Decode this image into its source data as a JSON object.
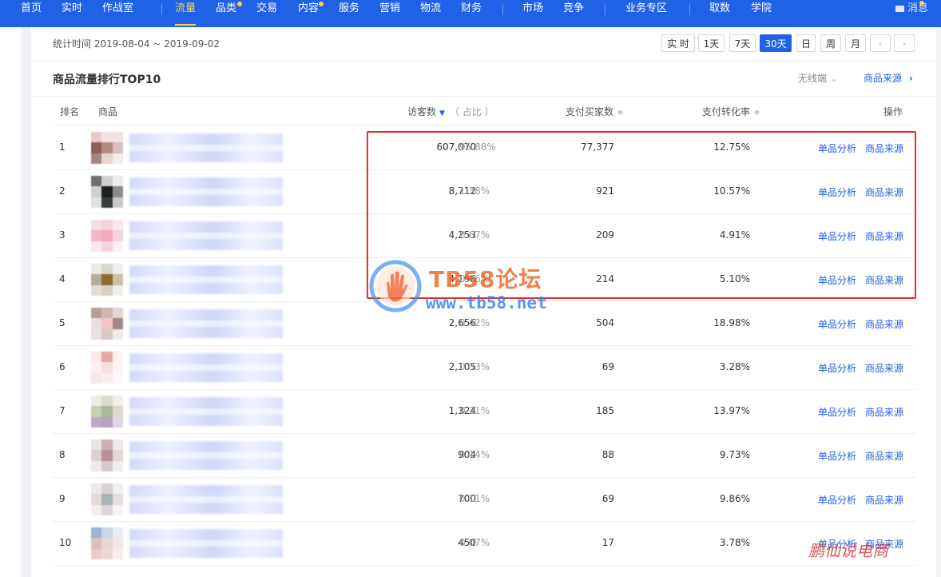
{
  "nav": {
    "items": [
      {
        "label": "首页",
        "active": false
      },
      {
        "label": "实时",
        "active": false
      },
      {
        "label": "作战室",
        "active": false
      },
      {
        "label": "流量",
        "active": true
      },
      {
        "label": "品类",
        "active": false,
        "dot": true
      },
      {
        "label": "交易",
        "active": false
      },
      {
        "label": "内容",
        "active": false,
        "dot": true
      },
      {
        "label": "服务",
        "active": false
      },
      {
        "label": "营销",
        "active": false
      },
      {
        "label": "物流",
        "active": false
      },
      {
        "label": "财务",
        "active": false
      },
      {
        "label": "市场",
        "active": false
      },
      {
        "label": "竞争",
        "active": false
      },
      {
        "label": "业务专区",
        "active": false
      },
      {
        "label": "取数",
        "active": false
      },
      {
        "label": "学院",
        "active": false
      }
    ],
    "message_label": "消息"
  },
  "date": {
    "range_text": "统计时间 2019-08-04 ~ 2019-09-02",
    "buttons": [
      {
        "label": "实 时",
        "active": false
      },
      {
        "label": "1天",
        "active": false
      },
      {
        "label": "7天",
        "active": false
      },
      {
        "label": "30天",
        "active": true
      },
      {
        "label": "日",
        "active": false
      },
      {
        "label": "周",
        "active": false
      },
      {
        "label": "月",
        "active": false
      }
    ],
    "prev_label": "‹",
    "next_label": "›"
  },
  "card": {
    "title": "商品流量排行TOP10",
    "device_label": "无线端",
    "source_link": "商品来源"
  },
  "table": {
    "headers": {
      "rank": "排名",
      "product": "商品",
      "visitors": "访客数",
      "share": "（ 占比 ）",
      "buyers": "支付买家数",
      "conversion": "支付转化率",
      "actions": "操作"
    },
    "action1": "单品分析",
    "action2": "商品来源",
    "rows": [
      {
        "rank": "1",
        "visitors": "607,070",
        "share": "95.88%",
        "buyers": "77,377",
        "conversion": "12.75%"
      },
      {
        "rank": "2",
        "visitors": "8,712",
        "share": "1.38%",
        "buyers": "921",
        "conversion": "10.57%"
      },
      {
        "rank": "3",
        "visitors": "4,253",
        "share": "0.67%",
        "buyers": "209",
        "conversion": "4.91%"
      },
      {
        "rank": "4",
        "visitors": "4,196",
        "share": "0.66%",
        "buyers": "214",
        "conversion": "5.10%"
      },
      {
        "rank": "5",
        "visitors": "2,656",
        "share": "0.42%",
        "buyers": "504",
        "conversion": "18.98%"
      },
      {
        "rank": "6",
        "visitors": "2,105",
        "share": "0.33%",
        "buyers": "69",
        "conversion": "3.28%"
      },
      {
        "rank": "7",
        "visitors": "1,324",
        "share": "0.21%",
        "buyers": "185",
        "conversion": "13.97%"
      },
      {
        "rank": "8",
        "visitors": "904",
        "share": "0.14%",
        "buyers": "88",
        "conversion": "9.73%"
      },
      {
        "rank": "9",
        "visitors": "700",
        "share": "0.11%",
        "buyers": "69",
        "conversion": "9.86%"
      },
      {
        "rank": "10",
        "visitors": "450",
        "share": "0.07%",
        "buyers": "17",
        "conversion": "3.78%"
      }
    ]
  },
  "watermark": {
    "brand": "TB58论坛",
    "url": "www.tb58.net",
    "corner": "鹏仙说电商"
  },
  "colors": {
    "nav_bg": "#2062e6",
    "nav_active": "#ffd34e",
    "link": "#2062e6",
    "highlight_box": "#e5312b"
  }
}
